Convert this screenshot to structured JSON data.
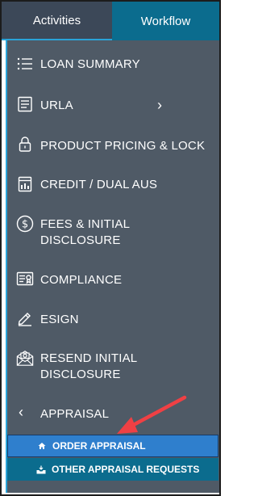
{
  "tabs": [
    {
      "label": "Activities",
      "active": true
    },
    {
      "label": "Workflow",
      "active": false
    }
  ],
  "menu": [
    {
      "label": "LOAN SUMMARY",
      "icon": "list-icon"
    },
    {
      "label": "URLA",
      "icon": "document-icon",
      "chevron": "›"
    },
    {
      "label": "PRODUCT PRICING & LOCK",
      "icon": "lock-icon"
    },
    {
      "label": "CREDIT / DUAL AUS",
      "icon": "credit-report-icon"
    },
    {
      "label_line1": "FEES & INITIAL",
      "label_line2": "DISCLOSURE",
      "icon": "dollar-icon"
    },
    {
      "label": "COMPLIANCE",
      "icon": "certificate-icon"
    },
    {
      "label": "ESIGN",
      "icon": "pen-icon"
    },
    {
      "label_line1": "RESEND INITIAL",
      "label_line2": "DISCLOSURE",
      "icon": "envelope-icon"
    },
    {
      "label": "APPRAISAL",
      "icon": "chevron-left-icon",
      "chevron": "‹"
    }
  ],
  "submenu": [
    {
      "label": "ORDER APPRAISAL",
      "icon": "home-icon",
      "active": true
    },
    {
      "label": "OTHER APPRAISAL REQUESTS",
      "icon": "tray-icon",
      "active": false
    }
  ],
  "colors": {
    "panel": "#4f5a66",
    "tab_active": "#3c4858",
    "tab_inactive": "#0b6c8e",
    "sub_active": "#2f7fcd",
    "accent_arrow": "#ef4044"
  }
}
